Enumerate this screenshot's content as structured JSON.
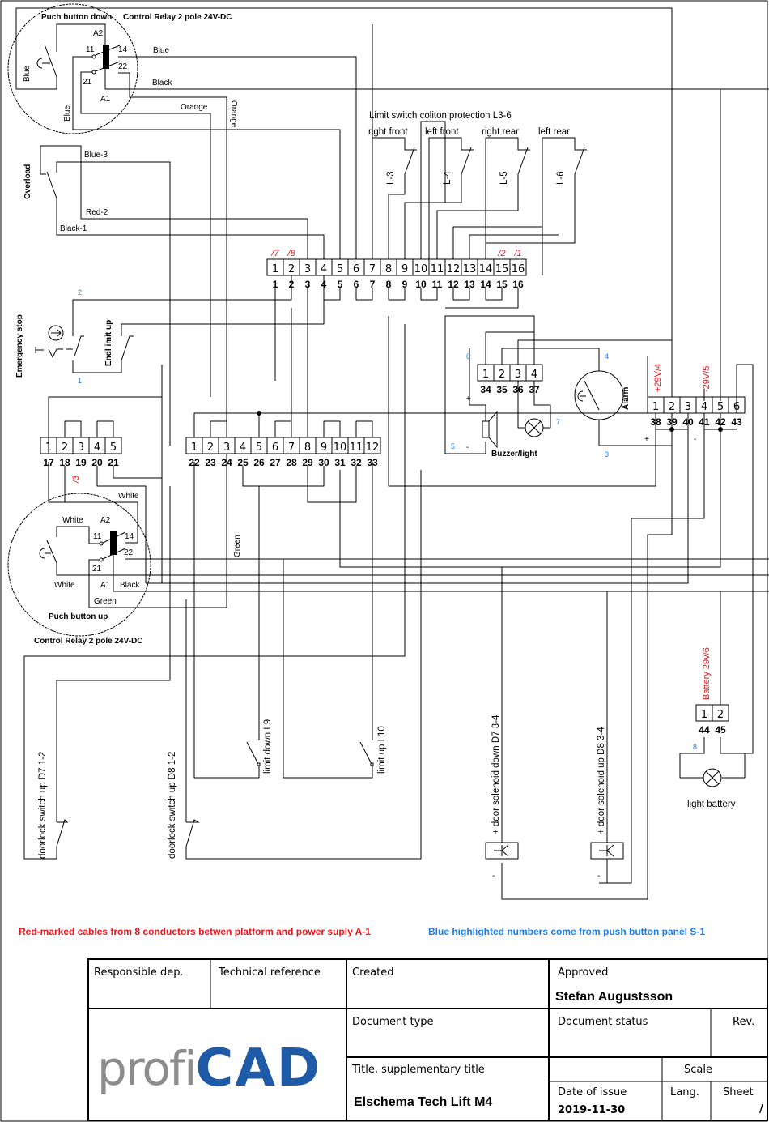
{
  "top_relay": {
    "title": "Puch button down",
    "relay_title": "Control Relay 2 pole 24V-DC",
    "pins": {
      "a2": "A2",
      "a1": "A1",
      "p11": "11",
      "p14": "14",
      "p21": "21",
      "p22": "22"
    },
    "wires": {
      "blue1": "Blue",
      "black": "Black",
      "orange_h": "Orange",
      "orange_v": "Orange",
      "blue_left": "Blue",
      "blue_lower": "Blue"
    }
  },
  "overload": {
    "label": "Overload",
    "wires": {
      "blue3": "Blue-3",
      "red2": "Red-2",
      "black1": "Black-1"
    }
  },
  "limit_switches": {
    "title": "Limit switch coliton protection L3-6",
    "items": [
      {
        "pos": "right front",
        "id": "L-3"
      },
      {
        "pos": "left front",
        "id": "L-4"
      },
      {
        "pos": "right rear",
        "id": "L-5"
      },
      {
        "pos": "left rear",
        "id": "L-6"
      }
    ]
  },
  "terminal_top": {
    "cells": [
      "1",
      "2",
      "3",
      "4",
      "5",
      "6",
      "7",
      "8",
      "9",
      "10",
      "11",
      "12",
      "13",
      "14",
      "15",
      "16"
    ],
    "numbers": [
      "1",
      "2",
      "3",
      "4",
      "5",
      "6",
      "7",
      "8",
      "9",
      "10",
      "11",
      "12",
      "13",
      "14",
      "15",
      "16"
    ],
    "red_marks": {
      "c1": "/7",
      "c2": "/8",
      "c15": "/2",
      "c16": "/1"
    }
  },
  "emergency": {
    "label": "Emergency stop",
    "endlimit": "Endl imit up",
    "blue_top": "2",
    "blue_bottom": "1"
  },
  "buzzer_block": {
    "cells": [
      "1",
      "2",
      "3",
      "4"
    ],
    "numbers": [
      "34",
      "35",
      "36",
      "37"
    ],
    "label": "Buzzer/light",
    "plus": "+",
    "minus": "-",
    "blue": {
      "six": "6",
      "five": "5",
      "seven": "7",
      "four": "4",
      "three": "3"
    }
  },
  "alarm": {
    "label": "Alarm"
  },
  "power_block": {
    "cells": [
      "1",
      "2",
      "3",
      "4",
      "5",
      "6"
    ],
    "numbers": [
      "38",
      "39",
      "40",
      "41",
      "42",
      "43"
    ],
    "red_plus": "+29V/4",
    "red_minus": "-29V/5",
    "plus": "+",
    "minus": "-"
  },
  "terminal_left": {
    "cells": [
      "1",
      "2",
      "3",
      "4",
      "5"
    ],
    "numbers": [
      "17",
      "18",
      "19",
      "20",
      "21"
    ],
    "red_mark": "/3"
  },
  "terminal_mid": {
    "cells": [
      "1",
      "2",
      "3",
      "4",
      "5",
      "6",
      "7",
      "8",
      "9",
      "10",
      "11",
      "12"
    ],
    "numbers": [
      "22",
      "23",
      "24",
      "25",
      "26",
      "27",
      "28",
      "29",
      "30",
      "31",
      "32",
      "33"
    ],
    "green": "Green"
  },
  "bottom_relay": {
    "title": "Puch button up",
    "relay_title": "Control Relay 2 pole 24V-DC",
    "pins": {
      "a2": "A2",
      "a1": "A1",
      "p11": "11",
      "p14": "14",
      "p21": "21",
      "p22": "22"
    },
    "wires": {
      "white_top": "White",
      "white_right": "White",
      "white_left": "White",
      "black": "Black",
      "green": "Green"
    }
  },
  "switches": {
    "limit_down": "limit down L9",
    "limit_up": "limit up L10",
    "doorlock_d7": "doorlock switch up D7 1-2",
    "doorlock_d8": "doorlock switch up D8 1-2",
    "solenoid_down": "+ door solenoid down D7 3-4",
    "solenoid_up": "+ door solenoid up D8 3-4",
    "minus": "-"
  },
  "battery": {
    "label": "Battery 29v/6",
    "cells": [
      "1",
      "2"
    ],
    "numbers": [
      "44",
      "45"
    ],
    "blue": "8",
    "lamp_label": "light battery"
  },
  "notes": {
    "red": "Red-marked cables from 8 conductors betwen platform and power suply A-1",
    "blue": "Blue highlighted numbers come from push button panel S-1",
    "red_color": "#e8161b",
    "blue_color": "#1e7ee0"
  },
  "title_block": {
    "responsible": "Responsible dep.",
    "technical": "Technical reference",
    "created": "Created",
    "approved": "Approved",
    "approver": "Stefan Augustsson",
    "doc_type": "Document type",
    "doc_status": "Document status",
    "rev": "Rev.",
    "title_label": "Title, supplementary title",
    "scale": "Scale",
    "title": "Elschema Tech Lift M4",
    "date_label": "Date of issue",
    "date": "2019-11-30",
    "lang": "Lang.",
    "sheet": "Sheet",
    "sheet_value": "/",
    "logo_profi": "profi",
    "logo_cad": "CAD",
    "logo_gray": "#8c8c8c",
    "logo_blue": "#1f5aa6"
  }
}
